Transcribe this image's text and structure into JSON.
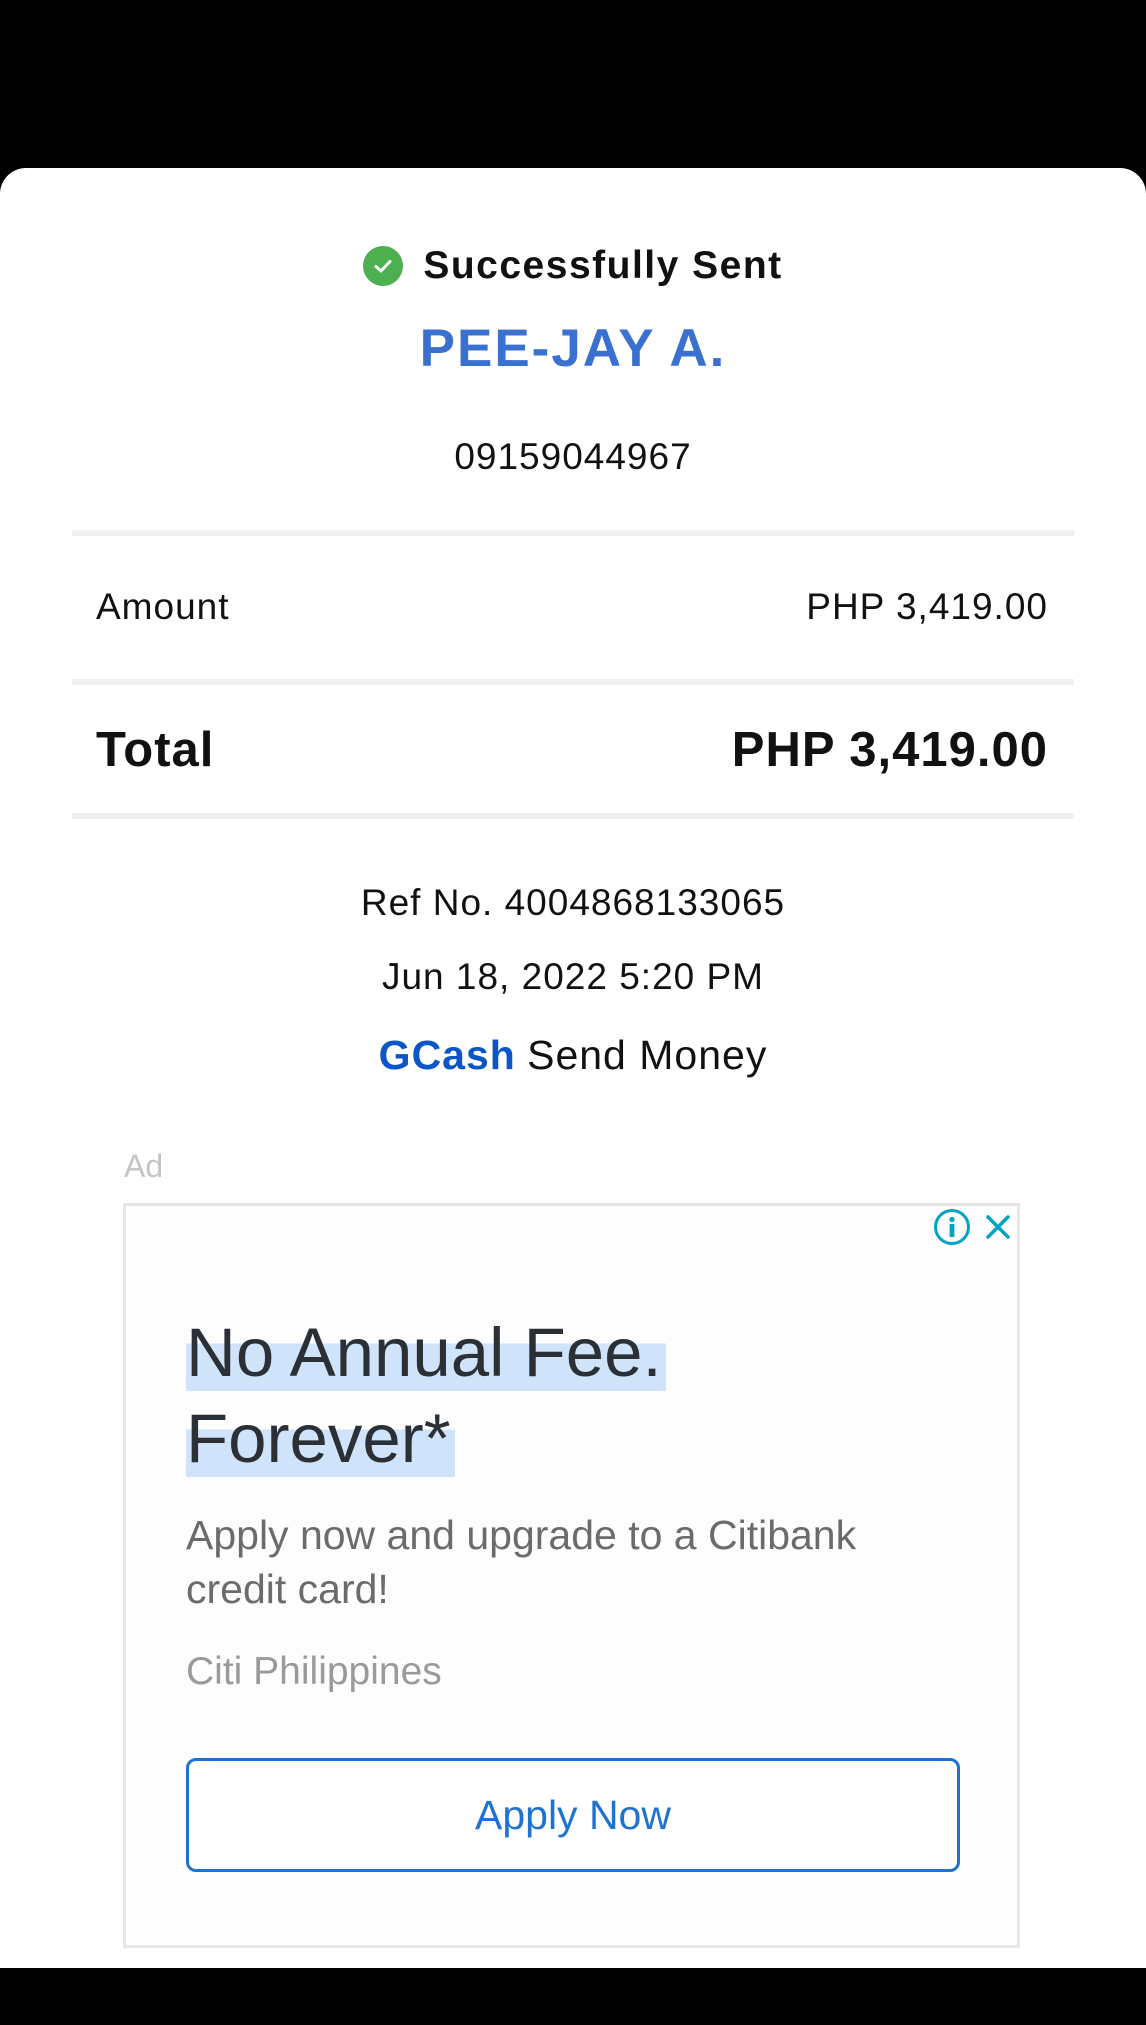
{
  "status": {
    "text": "Successfully Sent",
    "icon": "check-circle-icon",
    "color": "#4caf50"
  },
  "recipient": {
    "name": "PEE-JAY A.",
    "number": "09159044967"
  },
  "amount": {
    "label": "Amount",
    "value": "PHP 3,419.00"
  },
  "total": {
    "label": "Total",
    "value": "PHP 3,419.00"
  },
  "transaction": {
    "ref_no": "Ref No. 4004868133065",
    "datetime": "Jun 18, 2022 5:20 PM",
    "brand": "GCash",
    "type": "Send Money"
  },
  "ad": {
    "label": "Ad",
    "headline_line1": "No Annual Fee.",
    "headline_line2": "Forever*",
    "body": "Apply now and upgrade to a Citibank credit card!",
    "advertiser": "Citi Philippines",
    "cta": "Apply Now",
    "info_icon": "info-icon",
    "close_icon": "close-icon",
    "accent_color": "#1e73d2"
  },
  "colors": {
    "name_blue": "#3a70d0",
    "brand_blue": "#0a55c8"
  }
}
